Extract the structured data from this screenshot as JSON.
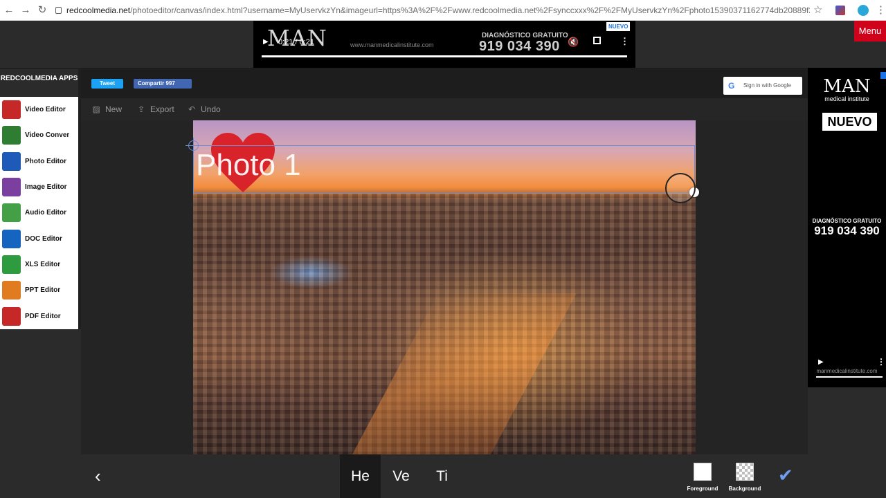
{
  "browser": {
    "url_host": "redcoolmedia.net",
    "url_path": "/photoeditor/canvas/index.html?username=MyUservkzYn&imageurl=https%3A%2F%2Fwww.redcoolmedia.net%2Fsynccxxx%2F%2FMyUservkzYn%2Fphoto15390371162774db20889f2d4.jpeg%..."
  },
  "top_ad": {
    "logo": "MAN",
    "time": "0:21 / 0:21",
    "site": "www.manmedicalinstitute.com",
    "diagnostic": "DIAGNÓSTICO GRATUITO",
    "phone": "919 034 390",
    "choices": "NUEVO"
  },
  "menu_label": "Menu",
  "apps": {
    "title": "REDCOOLMEDIA APPS",
    "items": [
      {
        "label": "Video Editor",
        "color": "#c62828"
      },
      {
        "label": "Video Conver",
        "color": "#2e7d32"
      },
      {
        "label": "Photo Editor",
        "color": "#1e5bb8"
      },
      {
        "label": "Image Editor",
        "color": "#7b3fa0"
      },
      {
        "label": "Audio Editor",
        "color": "#43a047"
      },
      {
        "label": "DOC Editor",
        "color": "#1565c0"
      },
      {
        "label": "XLS Editor",
        "color": "#2e9b3e"
      },
      {
        "label": "PPT Editor",
        "color": "#e07b1f"
      },
      {
        "label": "PDF Editor",
        "color": "#c62828"
      }
    ]
  },
  "share": {
    "tweet": "Tweet",
    "facebook": "Compartir 997",
    "google_signin": "Sign in with Google"
  },
  "toolbar": {
    "new": "New",
    "export": "Export",
    "undo": "Undo"
  },
  "canvas": {
    "overlay_text": "Photo 1",
    "heart_color": "#d8232a"
  },
  "bottom": {
    "modes": [
      {
        "label": "He",
        "active": true
      },
      {
        "label": "Ve",
        "active": false
      },
      {
        "label": "Ti",
        "active": false
      }
    ],
    "foreground_label": "Foreground",
    "background_label": "Background"
  },
  "right_ad": {
    "logo": "MAN",
    "subtitle": "medical institute",
    "badge": "NUEVO",
    "diagnostic": "DIAGNÓSTICO GRATUITO",
    "phone": "919 034 390",
    "site": "manmedicalinstitute.com"
  }
}
